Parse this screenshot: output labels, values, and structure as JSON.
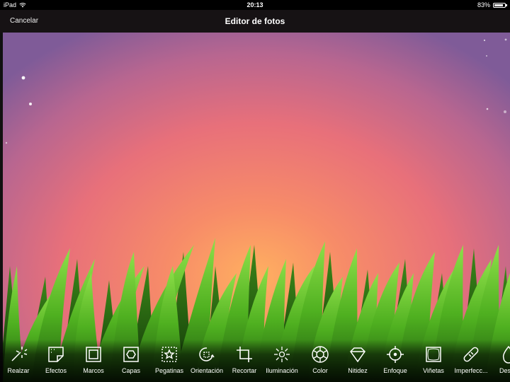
{
  "status": {
    "device": "iPad",
    "time": "20:13",
    "battery_text": "83%",
    "battery_level": 0.83
  },
  "nav": {
    "cancel_label": "Cancelar",
    "title": "Editor de fotos"
  },
  "toolbar": {
    "tools": [
      {
        "label": "Realzar",
        "icon": "magic-wand-icon"
      },
      {
        "label": "Efectos",
        "icon": "effects-icon"
      },
      {
        "label": "Marcos",
        "icon": "frames-icon"
      },
      {
        "label": "Capas",
        "icon": "layers-icon"
      },
      {
        "label": "Pegatinas",
        "icon": "stickers-icon"
      },
      {
        "label": "Orientación",
        "icon": "orientation-icon"
      },
      {
        "label": "Recortar",
        "icon": "crop-icon"
      },
      {
        "label": "Iluminación",
        "icon": "lighting-icon"
      },
      {
        "label": "Color",
        "icon": "color-icon"
      },
      {
        "label": "Nitidez",
        "icon": "sharpness-icon"
      },
      {
        "label": "Enfoque",
        "icon": "focus-icon"
      },
      {
        "label": "Viñetas",
        "icon": "vignette-icon"
      },
      {
        "label": "Imperfecc...",
        "icon": "blemish-icon"
      },
      {
        "label": "Desen",
        "icon": "drop-icon"
      }
    ]
  },
  "colors": {
    "sky_top": "#7f5b98",
    "sky_mid": "#e8707a",
    "sky_glow": "#ffb060",
    "grass_light": "#6fd030",
    "grass_dark": "#1d5a10"
  }
}
